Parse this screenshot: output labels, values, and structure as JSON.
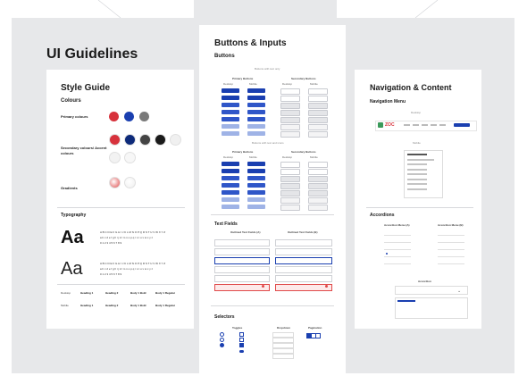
{
  "board": {
    "title": "UI Guidelines"
  },
  "style_guide": {
    "title": "Style Guide",
    "colours_label": "Colours",
    "primary_label": "Primary colours",
    "secondary_label": "Secondary colours/ Accent colours",
    "gradients_label": "Gradients",
    "primary_colors": [
      "#d7323c",
      "#1a3fb0",
      "#7a7a7a"
    ],
    "secondary_colors": [
      "#d7323c",
      "#0d2a7a",
      "#444444",
      "#1a1a1a",
      "#f0f0f0"
    ],
    "secondary_colors_row2": [
      "#f2f2f2",
      "#f7f7f7"
    ],
    "gradient_colors": [
      "#e04a4a",
      "#eeeeee"
    ],
    "typography_label": "Typography",
    "sample_glyph": "Aa",
    "alphabet_upper": "A B C D E F G H I J K L M N O P Q R S T U V W X Y Z",
    "alphabet_lower": "a b c d e f g h i j k l m n o p q r s t u v w x y z",
    "digits": "0 1 2 3 4 5 6 7 8 9",
    "font_rows": [
      {
        "label": "Desktop",
        "cols": [
          "Heading 1",
          "Heading 2",
          "Body 1 Bold",
          "Body 1 Regular"
        ]
      },
      {
        "label": "Mobile",
        "cols": [
          "Heading 1",
          "Heading 2",
          "Body 1 Bold",
          "Body 1 Regular"
        ]
      }
    ]
  },
  "buttons_inputs": {
    "title": "Buttons & Inputs",
    "buttons_label": "Buttons",
    "text_only_label": "Buttons with text only",
    "text_icon_label": "Buttons with text and icons",
    "primary_label": "Primary Buttons",
    "secondary_label": "Secondary Buttons",
    "desktop": "Desktop",
    "mobile": "Mobile",
    "text_fields_label": "Text Fields",
    "outlined_a": "Outlined Text Fields (A)",
    "outlined_b": "Outlined Text Fields (B)",
    "selectors_label": "Selectors",
    "toggles": "Toggles",
    "dropdown": "Dropdown",
    "pagination": "Pagination",
    "brand_blue": "#1a3fb0",
    "error_red": "#e04a4a"
  },
  "navigation": {
    "title": "Navigation & Content",
    "menu_label": "Navigation Menu",
    "desktop": "Desktop",
    "mobile": "Mobile",
    "logo_text": "ZOC",
    "accordions_label": "Accordions",
    "accordion_a": "Accordion Menu (A)",
    "accordion_b": "Accordion Menu (B)",
    "accordion_c": "Accordion"
  }
}
